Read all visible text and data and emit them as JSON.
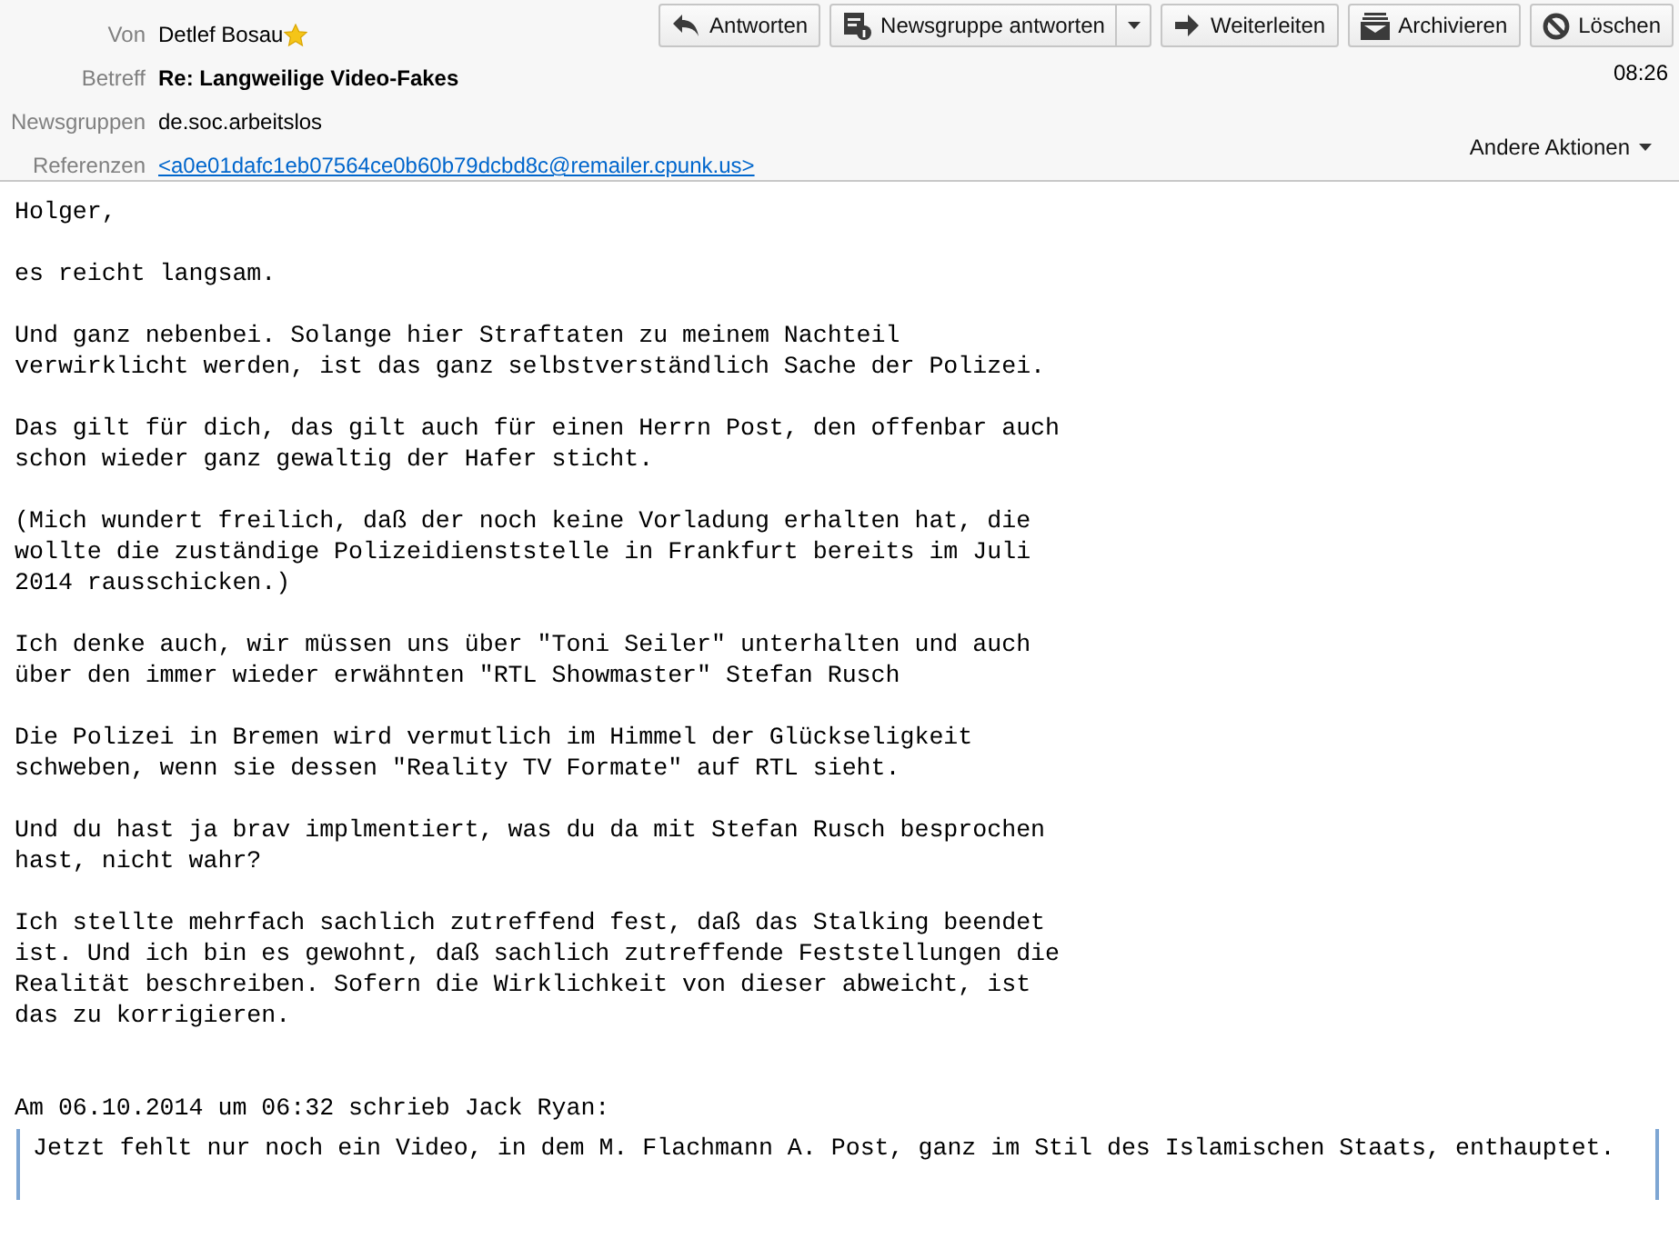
{
  "header": {
    "fields": [
      {
        "label": "Von",
        "value": "Detlef Bosau",
        "kind": "sender"
      },
      {
        "label": "Betreff",
        "value": "Re: Langweilige Video-Fakes",
        "kind": "subject"
      },
      {
        "label": "Newsgruppen",
        "value": "de.soc.arbeitslos",
        "kind": "plain"
      },
      {
        "label": "Referenzen",
        "value": "<a0e01dafc1eb07564ce0b60b79dcbd8c@remailer.cpunk.us>",
        "kind": "link"
      }
    ],
    "buttons": [
      {
        "label": "Antworten",
        "kind": "plain"
      },
      {
        "label": "Newsgruppe antworten",
        "kind": "split"
      },
      {
        "label": "Weiterleiten",
        "kind": "plain"
      },
      {
        "label": "Archivieren",
        "kind": "plain"
      },
      {
        "label": "Löschen",
        "kind": "plain"
      }
    ],
    "time": "08:26",
    "more_actions": "Andere Aktionen"
  },
  "body": {
    "paragraphs": [
      [
        "Holger,"
      ],
      [
        "es reicht langsam."
      ],
      [
        "Und ganz nebenbei. Solange hier Straftaten zu meinem Nachteil",
        "verwirklicht werden, ist das ganz selbstverständlich Sache der Polizei."
      ],
      [
        "Das gilt für dich, das gilt auch für einen Herrn Post, den offenbar auch",
        "schon wieder ganz gewaltig der Hafer sticht."
      ],
      [
        "(Mich wundert freilich, daß der noch keine Vorladung erhalten hat, die",
        "wollte die zuständige Polizeidienststelle in Frankfurt bereits im Juli",
        "2014 rausschicken.)"
      ],
      [
        "Ich denke auch, wir müssen uns über \"Toni Seiler\" unterhalten und auch",
        "über den immer wieder erwähnten \"RTL Showmaster\" Stefan Rusch"
      ],
      [
        "Die Polizei in Bremen wird vermutlich im Himmel der Glückseligkeit",
        "schweben, wenn sie dessen \"Reality TV Formate\" auf RTL sieht."
      ],
      [
        "Und du hast ja brav implmentiert, was du da mit Stefan Rusch besprochen",
        "hast, nicht wahr?"
      ],
      [
        "Ich stellte mehrfach sachlich zutreffend fest, daß das Stalking beendet",
        "ist. Und ich bin es gewohnt, daß sachlich zutreffende Feststellungen die",
        "Realität beschreiben. Sofern die Wirklichkeit von dieser abweicht, ist",
        "das zu korrigieren."
      ]
    ],
    "attribution": "Am 06.10.2014 um 06:32 schrieb Jack Ryan:",
    "quote": "Jetzt fehlt nur noch ein Video, in dem M. Flachmann A. Post, ganz im Stil des Islamischen Staats, enthauptet."
  }
}
